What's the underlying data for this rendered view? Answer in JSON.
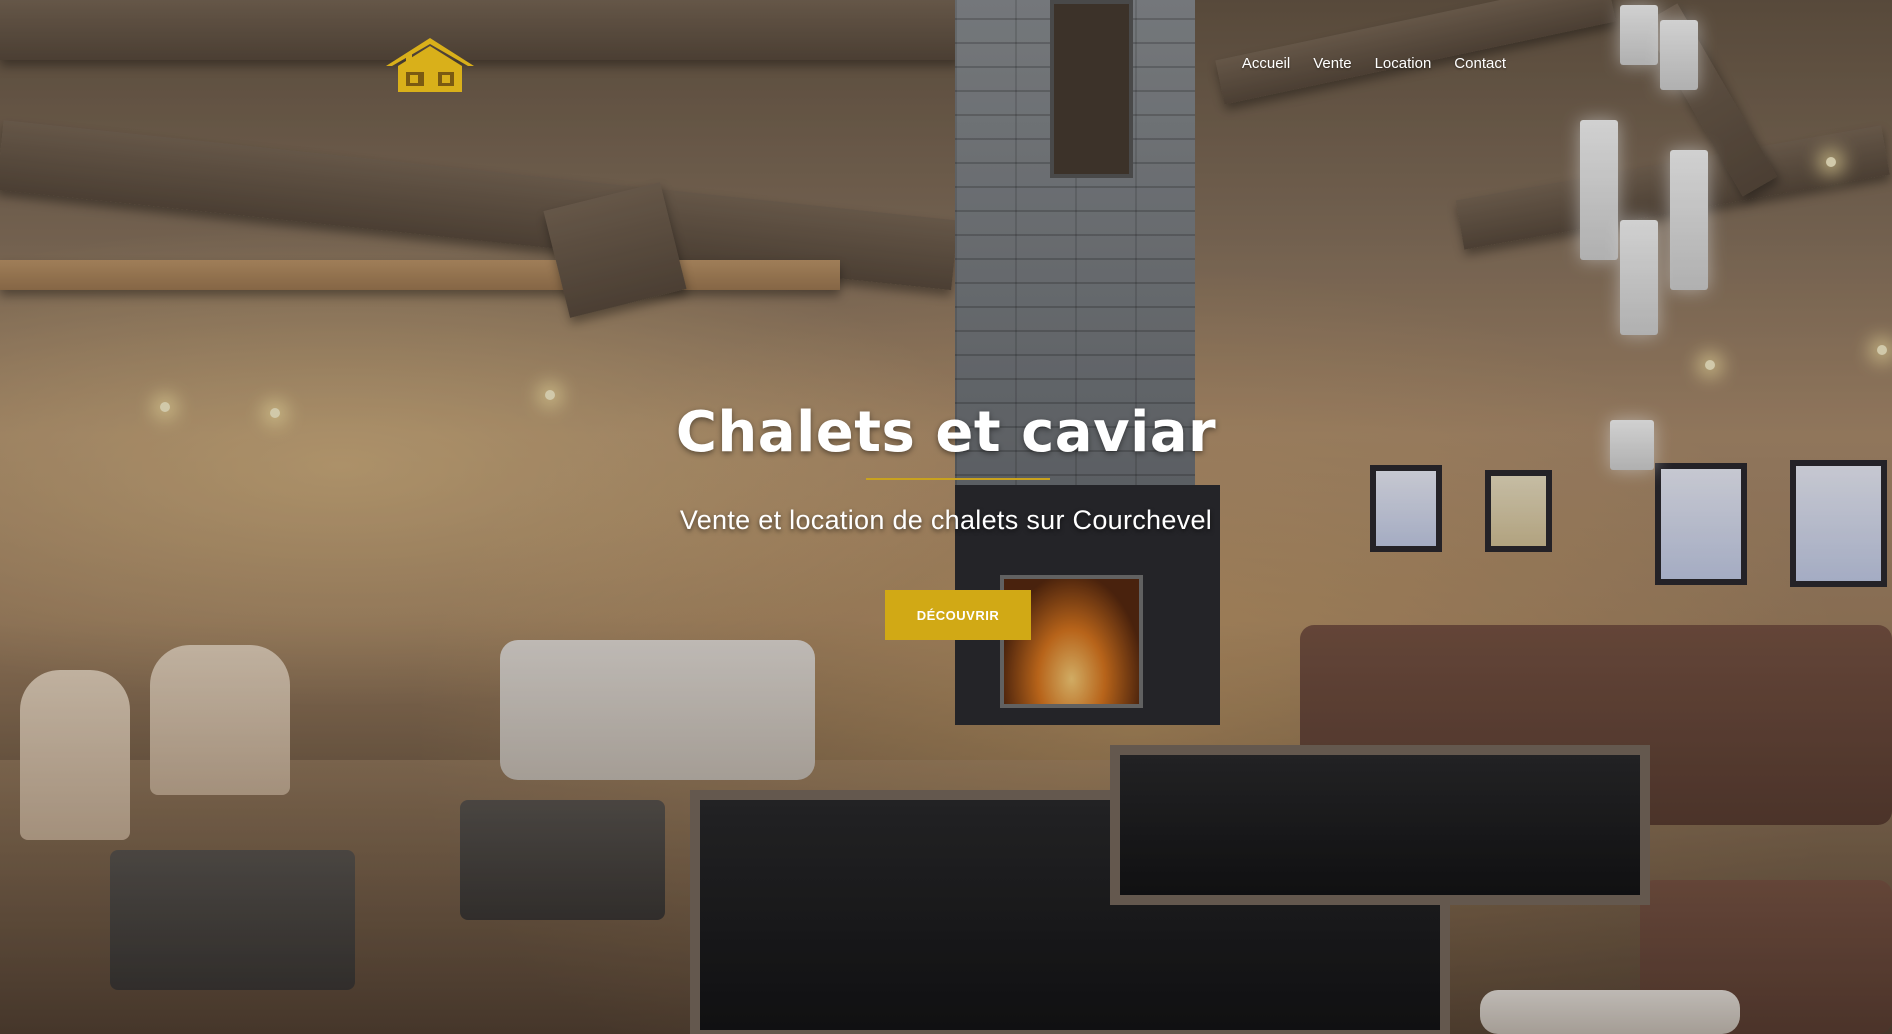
{
  "header": {
    "logo_icon": "house-logo-icon",
    "nav": [
      {
        "label": "Accueil"
      },
      {
        "label": "Vente"
      },
      {
        "label": "Location"
      },
      {
        "label": "Contact"
      }
    ]
  },
  "hero": {
    "title": "Chalets et caviar",
    "subtitle": "Vente et location de chalets sur Courchevel",
    "cta_label": "DÉCOUVRIR",
    "background": "chalet-living-room-photo"
  },
  "colors": {
    "accent": "#d1a915",
    "divider": "#c9a21e",
    "logo": "#d9b01a",
    "text": "#ffffff"
  }
}
